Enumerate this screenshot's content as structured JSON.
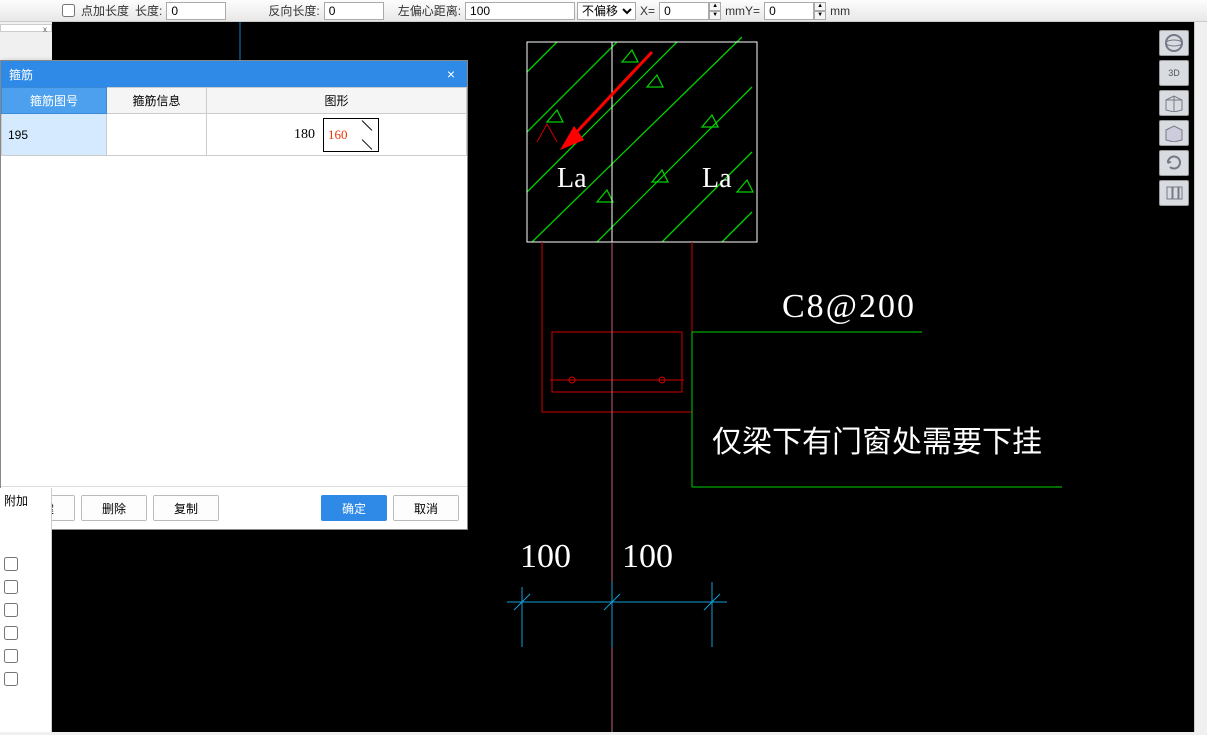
{
  "toolbar": {
    "checkbox_label": "点加长度",
    "length_label": "长度:",
    "length_value": "0",
    "reverse_label": "反向长度:",
    "reverse_value": "0",
    "left_offset_label": "左偏心距离:",
    "left_offset_value": "100",
    "offset_select": "不偏移",
    "x_label": "X=",
    "x_value": "0",
    "y_label": "mmY=",
    "y_value": "0",
    "mm": "mm"
  },
  "dialog": {
    "title": "箍筋",
    "close": "×",
    "headers": {
      "num": "箍筋图号",
      "info": "箍筋信息",
      "shape": "图形"
    },
    "row": {
      "num": "195",
      "dim1": "180",
      "dim2": "160"
    },
    "buttons": {
      "new": "新建",
      "delete": "删除",
      "copy": "复制",
      "ok": "确定",
      "cancel": "取消"
    }
  },
  "left": {
    "fujia": "附加",
    "close": "x"
  },
  "canvas": {
    "la1": "La",
    "la2": "La",
    "rebar": "C8@200",
    "note": "仅梁下有门窗处需要下挂",
    "dim1": "100",
    "dim2": "100"
  },
  "nav": {
    "cube3d": "3D"
  }
}
